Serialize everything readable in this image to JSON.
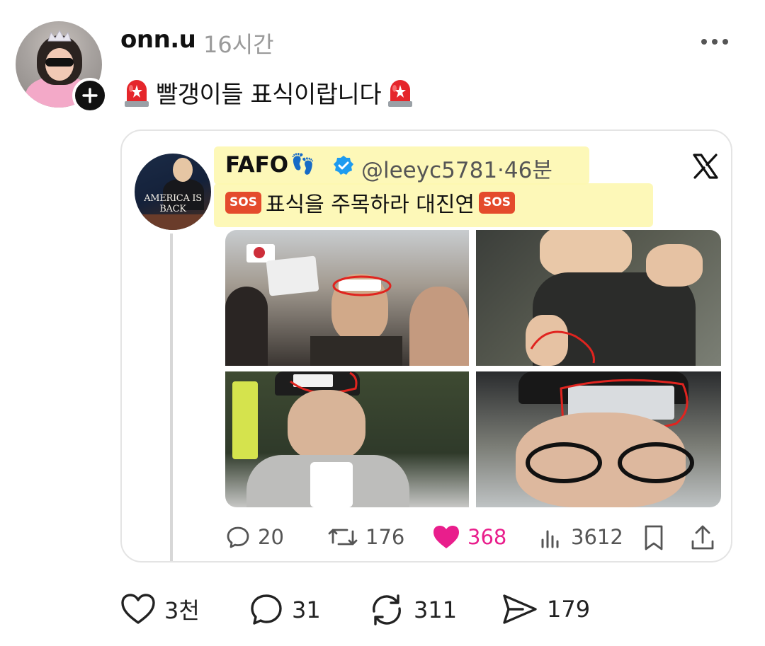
{
  "post": {
    "username": "onn.u",
    "time": "16시간",
    "text": "빨갱이들 표식이랍니다"
  },
  "quoted": {
    "name": "FAFO",
    "handle": "@leeyc5781",
    "time_sep": "·",
    "time": "46분",
    "sos_badge": "SOS",
    "text": "표식을 주목하라 대진연",
    "avatar_text": "AMERICA IS BACK",
    "stats": {
      "replies": "20",
      "reposts": "176",
      "likes": "368",
      "views": "3612"
    }
  },
  "actions": {
    "likes": "3천",
    "replies": "31",
    "reposts": "311",
    "shares": "179"
  },
  "colors": {
    "like_pink": "#e91e8c",
    "verified_blue": "#1d9bf0",
    "highlight": "#fdf7b0",
    "annotation_red": "#e0241f"
  },
  "icons": [
    "siren-icon",
    "plus-icon",
    "more-icon",
    "verified-icon",
    "x-logo-icon",
    "reply-icon",
    "repost-icon",
    "heart-icon",
    "views-icon",
    "bookmark-icon",
    "share-icon",
    "send-icon"
  ]
}
